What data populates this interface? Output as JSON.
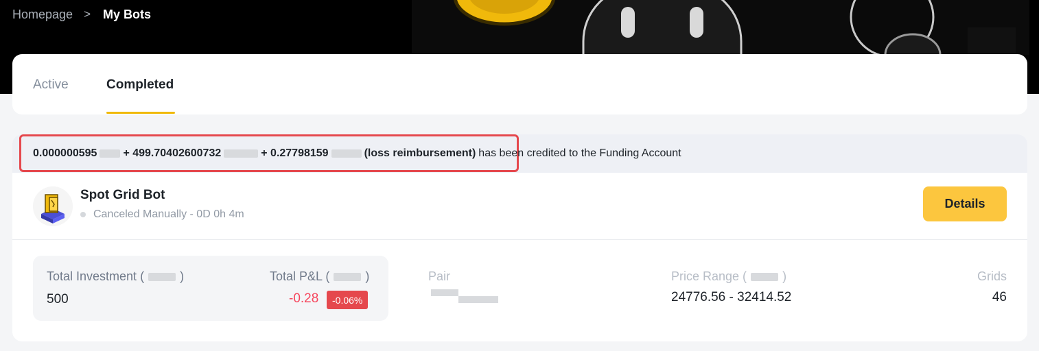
{
  "breadcrumb": {
    "home": "Homepage",
    "separator": ">",
    "current": "My Bots"
  },
  "tabs": [
    {
      "label": "Active",
      "selected": false
    },
    {
      "label": "Completed",
      "selected": true
    }
  ],
  "notice": {
    "part1": "0.000000595",
    "part2": "+ 499.70402600732",
    "part3": "+ 0.27798159",
    "part4": "(loss reimbursement)",
    "rest": "has been credited to the Funding Account"
  },
  "bot": {
    "title": "Spot Grid Bot",
    "status": "Canceled Manually - 0D 0h 4m",
    "details_label": "Details"
  },
  "stats": {
    "total_investment_label": "Total Investment (",
    "total_investment_close": ")",
    "total_investment_value": "500",
    "total_pnl_label": "Total P&L (",
    "total_pnl_close": ")",
    "total_pnl_value": "-0.28",
    "total_pnl_pct": "-0.06%",
    "pair_label": "Pair",
    "price_range_label": "Price Range (",
    "price_range_close": ")",
    "price_range_value": "24776.56 - 32414.52",
    "grids_label": "Grids",
    "grids_value": "46"
  },
  "colors": {
    "accent": "#f0b90b",
    "button": "#fcc63e",
    "loss": "#f6465d",
    "highlight_border": "#e5484d"
  }
}
